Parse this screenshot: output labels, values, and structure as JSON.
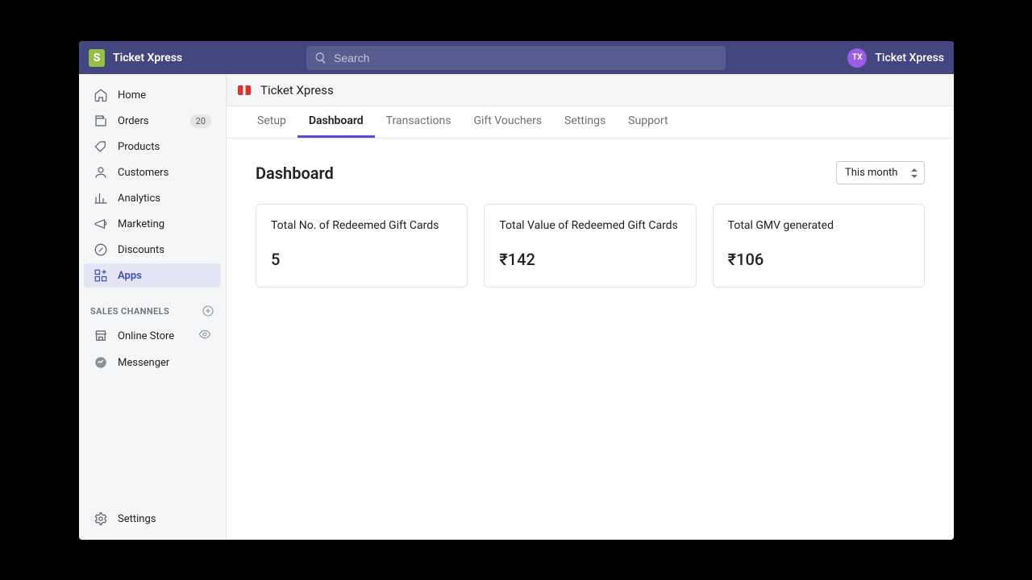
{
  "header": {
    "store_name": "Ticket Xpress",
    "search_placeholder": "Search",
    "profile_initials": "TX",
    "profile_name": "Ticket Xpress"
  },
  "sidebar": {
    "items": [
      {
        "label": "Home"
      },
      {
        "label": "Orders",
        "badge": "20"
      },
      {
        "label": "Products"
      },
      {
        "label": "Customers"
      },
      {
        "label": "Analytics"
      },
      {
        "label": "Marketing"
      },
      {
        "label": "Discounts"
      },
      {
        "label": "Apps"
      }
    ],
    "channels_header": "SALES CHANNELS",
    "channels": [
      {
        "label": "Online Store"
      },
      {
        "label": "Messenger"
      }
    ],
    "settings_label": "Settings"
  },
  "app": {
    "header_title": "Ticket Xpress",
    "tabs": [
      "Setup",
      "Dashboard",
      "Transactions",
      "Gift Vouchers",
      "Settings",
      "Support"
    ],
    "active_tab": "Dashboard"
  },
  "dashboard": {
    "title": "Dashboard",
    "period": "This month",
    "cards": [
      {
        "label": "Total No. of Redeemed Gift Cards",
        "value": "5"
      },
      {
        "label": "Total Value of Redeemed Gift Cards",
        "value": "₹142"
      },
      {
        "label": "Total GMV generated",
        "value": "₹106"
      }
    ]
  }
}
